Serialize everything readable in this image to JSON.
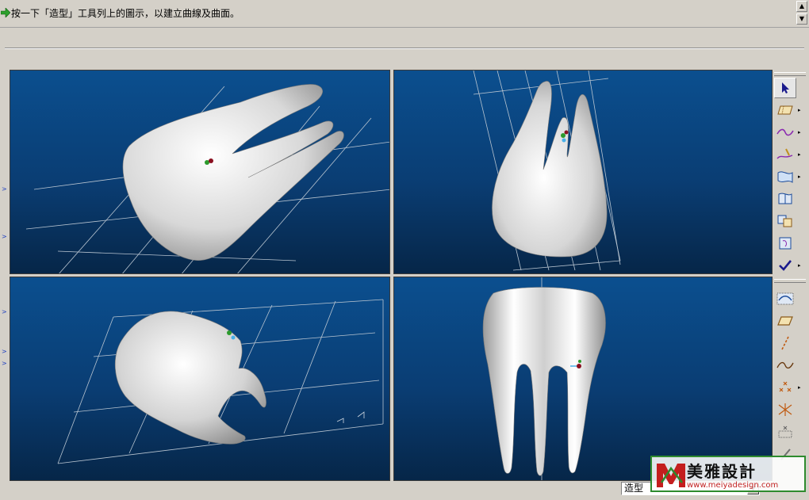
{
  "message_bar": {
    "prompt": "按一下「造型」工具列上的圖示，以建立曲線及曲面。"
  },
  "icons": {
    "message": "green-arrow-icon",
    "scroll_up": "scroll-up-icon",
    "scroll_down": "scroll-down-icon"
  },
  "toolbar_top": [
    {
      "name": "select-arrow-icon",
      "selected": true,
      "has_menu": false
    },
    {
      "name": "datum-plane-icon",
      "selected": false,
      "has_menu": true
    },
    {
      "name": "curve-icon",
      "selected": false,
      "has_menu": true
    },
    {
      "name": "sketch-curve-icon",
      "selected": false,
      "has_menu": true
    },
    {
      "name": "boundary-surface-icon",
      "selected": false,
      "has_menu": true
    },
    {
      "name": "curve-surface-icon",
      "selected": false,
      "has_menu": false
    },
    {
      "name": "connect-surface-icon",
      "selected": false,
      "has_menu": false
    },
    {
      "name": "trim-surface-icon",
      "selected": false,
      "has_menu": false
    },
    {
      "name": "done-check-icon",
      "selected": false,
      "has_menu": true
    }
  ],
  "toolbar_bottom": [
    {
      "name": "curve-from-surface-icon",
      "has_menu": false
    },
    {
      "name": "plane-icon",
      "has_menu": false
    },
    {
      "name": "dashed-line-icon",
      "has_menu": false
    },
    {
      "name": "freeform-curve-icon",
      "has_menu": false
    },
    {
      "name": "points-icon",
      "has_menu": true
    },
    {
      "name": "intersect-points-icon",
      "has_menu": false
    },
    {
      "name": "grid-points-icon",
      "has_menu": false
    },
    {
      "name": "pen-icon",
      "has_menu": false
    }
  ],
  "status": {
    "mode": "造型"
  },
  "watermark": {
    "title": "美雅設計",
    "url": "www.meiyadesign.com"
  },
  "colors": {
    "viewport_top": "#0b4f8f",
    "viewport_bottom": "#062648",
    "ui_face": "#d4d0c8",
    "check": "#1a1a8c"
  }
}
